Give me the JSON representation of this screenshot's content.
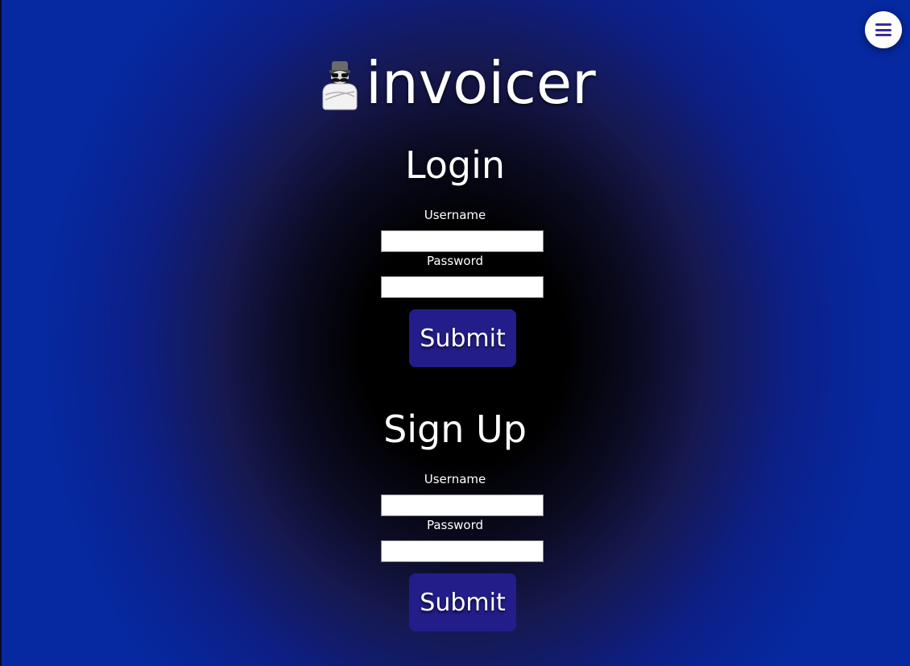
{
  "app": {
    "title": "invoicer",
    "logo_icon": "mustached-man-icon"
  },
  "menu": {
    "icon": "hamburger-menu-icon"
  },
  "login": {
    "title": "Login",
    "username_label": "Username",
    "username_value": "",
    "password_label": "Password",
    "password_value": "",
    "submit_label": "Submit"
  },
  "signup": {
    "title": "Sign Up",
    "username_label": "Username",
    "username_value": "",
    "password_label": "Password",
    "password_value": "",
    "submit_label": "Submit"
  },
  "colors": {
    "background_outer": "#0628a0",
    "background_center": "#000000",
    "button": "#231d8a",
    "menu_icon": "#3a2c9a"
  }
}
